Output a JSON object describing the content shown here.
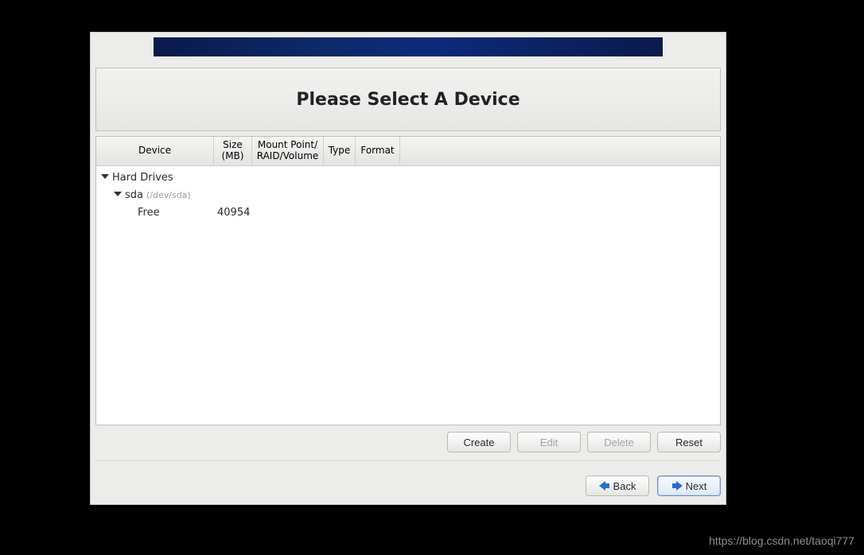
{
  "title": "Please Select A Device",
  "columns": {
    "device": "Device",
    "size": "Size\n(MB)",
    "mount": "Mount Point/\nRAID/Volume",
    "type": "Type",
    "format": "Format"
  },
  "tree": {
    "root_label": "Hard Drives",
    "drive": {
      "name": "sda",
      "path": "(/dev/sda)"
    },
    "free": {
      "label": "Free",
      "size": "40954"
    }
  },
  "actions": {
    "create": "Create",
    "edit": "Edit",
    "delete": "Delete",
    "reset": "Reset"
  },
  "nav": {
    "back": "Back",
    "next": "Next"
  },
  "watermark": "https://blog.csdn.net/taoqi777"
}
